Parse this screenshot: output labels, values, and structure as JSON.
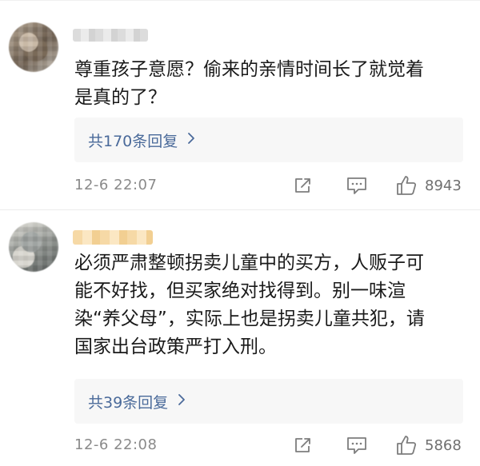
{
  "comments": [
    {
      "text": "尊重孩子意愿？偷来的亲情时间长了就觉着\n是真的了？",
      "replies_label": "共170条回复",
      "timestamp": "12-6 22:07",
      "likes": "8943",
      "icons": [
        "share-icon",
        "comment-icon",
        "thumbs-up-icon",
        "chevron-right-icon"
      ]
    },
    {
      "text": "必须严肃整顿拐卖儿童中的买方，人贩子可\n能不好找，但买家绝对找得到。别一味渲\n染“养父母”，实际上也是拐卖儿童共犯，请\n国家出台政策严打入刑。",
      "replies_label": "共39条回复",
      "timestamp": "12-6 22:08",
      "likes": "5868",
      "icons": [
        "share-icon",
        "comment-icon",
        "thumbs-up-icon",
        "chevron-right-icon"
      ]
    }
  ],
  "colors": {
    "link": "#4a6a9a",
    "meta": "#8a8a8a",
    "reply_bg": "#f7f7f7"
  }
}
